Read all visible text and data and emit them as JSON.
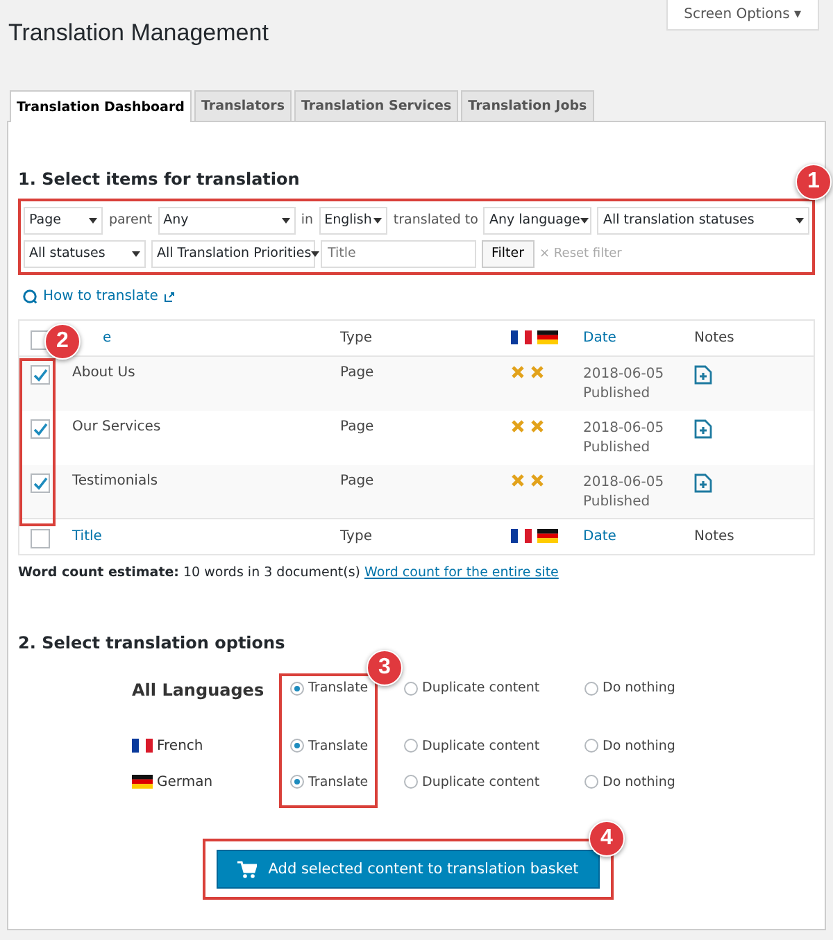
{
  "page_title": "Translation Management",
  "screen_options": "Screen Options ▾",
  "tabs": [
    {
      "label": "Translation Dashboard",
      "selected": true
    },
    {
      "label": "Translators",
      "selected": false
    },
    {
      "label": "Translation Services",
      "selected": false
    },
    {
      "label": "Translation Jobs",
      "selected": false
    }
  ],
  "section_1": {
    "heading": "1. Select items for translation",
    "filter_rows": [
      [
        {
          "kind": "select",
          "value": "Page"
        },
        {
          "kind": "text",
          "text": "parent"
        },
        {
          "kind": "select",
          "value": "Any"
        },
        {
          "kind": "text",
          "text": "in"
        },
        {
          "kind": "select",
          "value": "English"
        },
        {
          "kind": "text",
          "text": "translated to"
        },
        {
          "kind": "select",
          "value": "Any language"
        },
        {
          "kind": "select",
          "value": "All translation statuses"
        }
      ],
      [
        {
          "kind": "select",
          "value": "All statuses"
        },
        {
          "kind": "select",
          "value": "All Translation Priorities"
        },
        {
          "kind": "input",
          "placeholder": "Title"
        },
        {
          "kind": "button",
          "text": "Filter"
        },
        {
          "kind": "link",
          "text": "× Reset filter",
          "disabled": true
        }
      ]
    ],
    "help_link": "How to translate",
    "table": {
      "header_checked": false,
      "footer_checked": false,
      "columns": [
        "e",
        "Type",
        "Date",
        "Notes"
      ],
      "footer_columns": [
        "Title",
        "Type",
        "Date",
        "Notes"
      ],
      "rows": [
        {
          "checked": true,
          "title": "About Us",
          "type": "Page",
          "date": "2018-06-05",
          "status": "Published"
        },
        {
          "checked": true,
          "title": "Our Services",
          "type": "Page",
          "date": "2018-06-05",
          "status": "Published"
        },
        {
          "checked": true,
          "title": "Testimonials",
          "type": "Page",
          "date": "2018-06-05",
          "status": "Published"
        }
      ]
    },
    "word_count": "**Word count estimate:** 10 words in 3 document(s)",
    "word_count_link": "Word count for the entire site"
  },
  "section_2": {
    "heading": "2. Select translation options",
    "languages": [
      {
        "name": "All Languages",
        "kind": "all",
        "options": [
          {
            "label": "Translate",
            "selected": true
          },
          {
            "label": "Duplicate content",
            "selected": false
          },
          {
            "label": "Do nothing",
            "selected": false
          }
        ]
      },
      {
        "name": "French",
        "kind": "fr",
        "options": [
          {
            "label": "Translate",
            "selected": true
          },
          {
            "label": "Duplicate content",
            "selected": false
          },
          {
            "label": "Do nothing",
            "selected": false
          }
        ]
      },
      {
        "name": "German",
        "kind": "de",
        "options": [
          {
            "label": "Translate",
            "selected": true
          },
          {
            "label": "Duplicate content",
            "selected": false
          },
          {
            "label": "Do nothing",
            "selected": false
          }
        ]
      }
    ],
    "submit": "Add selected content to translation basket"
  },
  "annotations": [
    {
      "label": "1"
    },
    {
      "label": "2"
    },
    {
      "label": "3"
    },
    {
      "label": "4"
    }
  ]
}
